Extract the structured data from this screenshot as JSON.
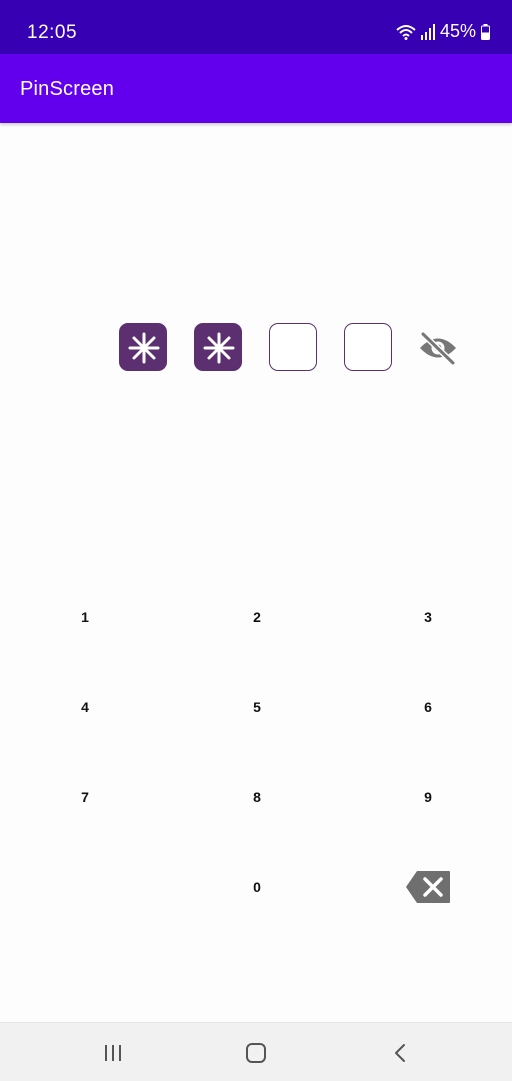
{
  "status_bar": {
    "time": "12:05",
    "battery": "45%",
    "icons": [
      "wifi-icon",
      "signal-icon",
      "battery-icon"
    ]
  },
  "app_bar": {
    "title": "PinScreen",
    "color": "#6200ee"
  },
  "pin": {
    "length": 4,
    "filled": 2,
    "mask_icon": "asterisk-icon",
    "visibility_icon": "eye-off-icon",
    "box_color": "#5b2f70"
  },
  "keypad": {
    "keys": [
      "1",
      "2",
      "3",
      "4",
      "5",
      "6",
      "7",
      "8",
      "9",
      "0"
    ],
    "delete_icon": "backspace-icon"
  },
  "nav_bar": {
    "icons": [
      "recent-apps-icon",
      "home-icon",
      "back-icon"
    ]
  }
}
